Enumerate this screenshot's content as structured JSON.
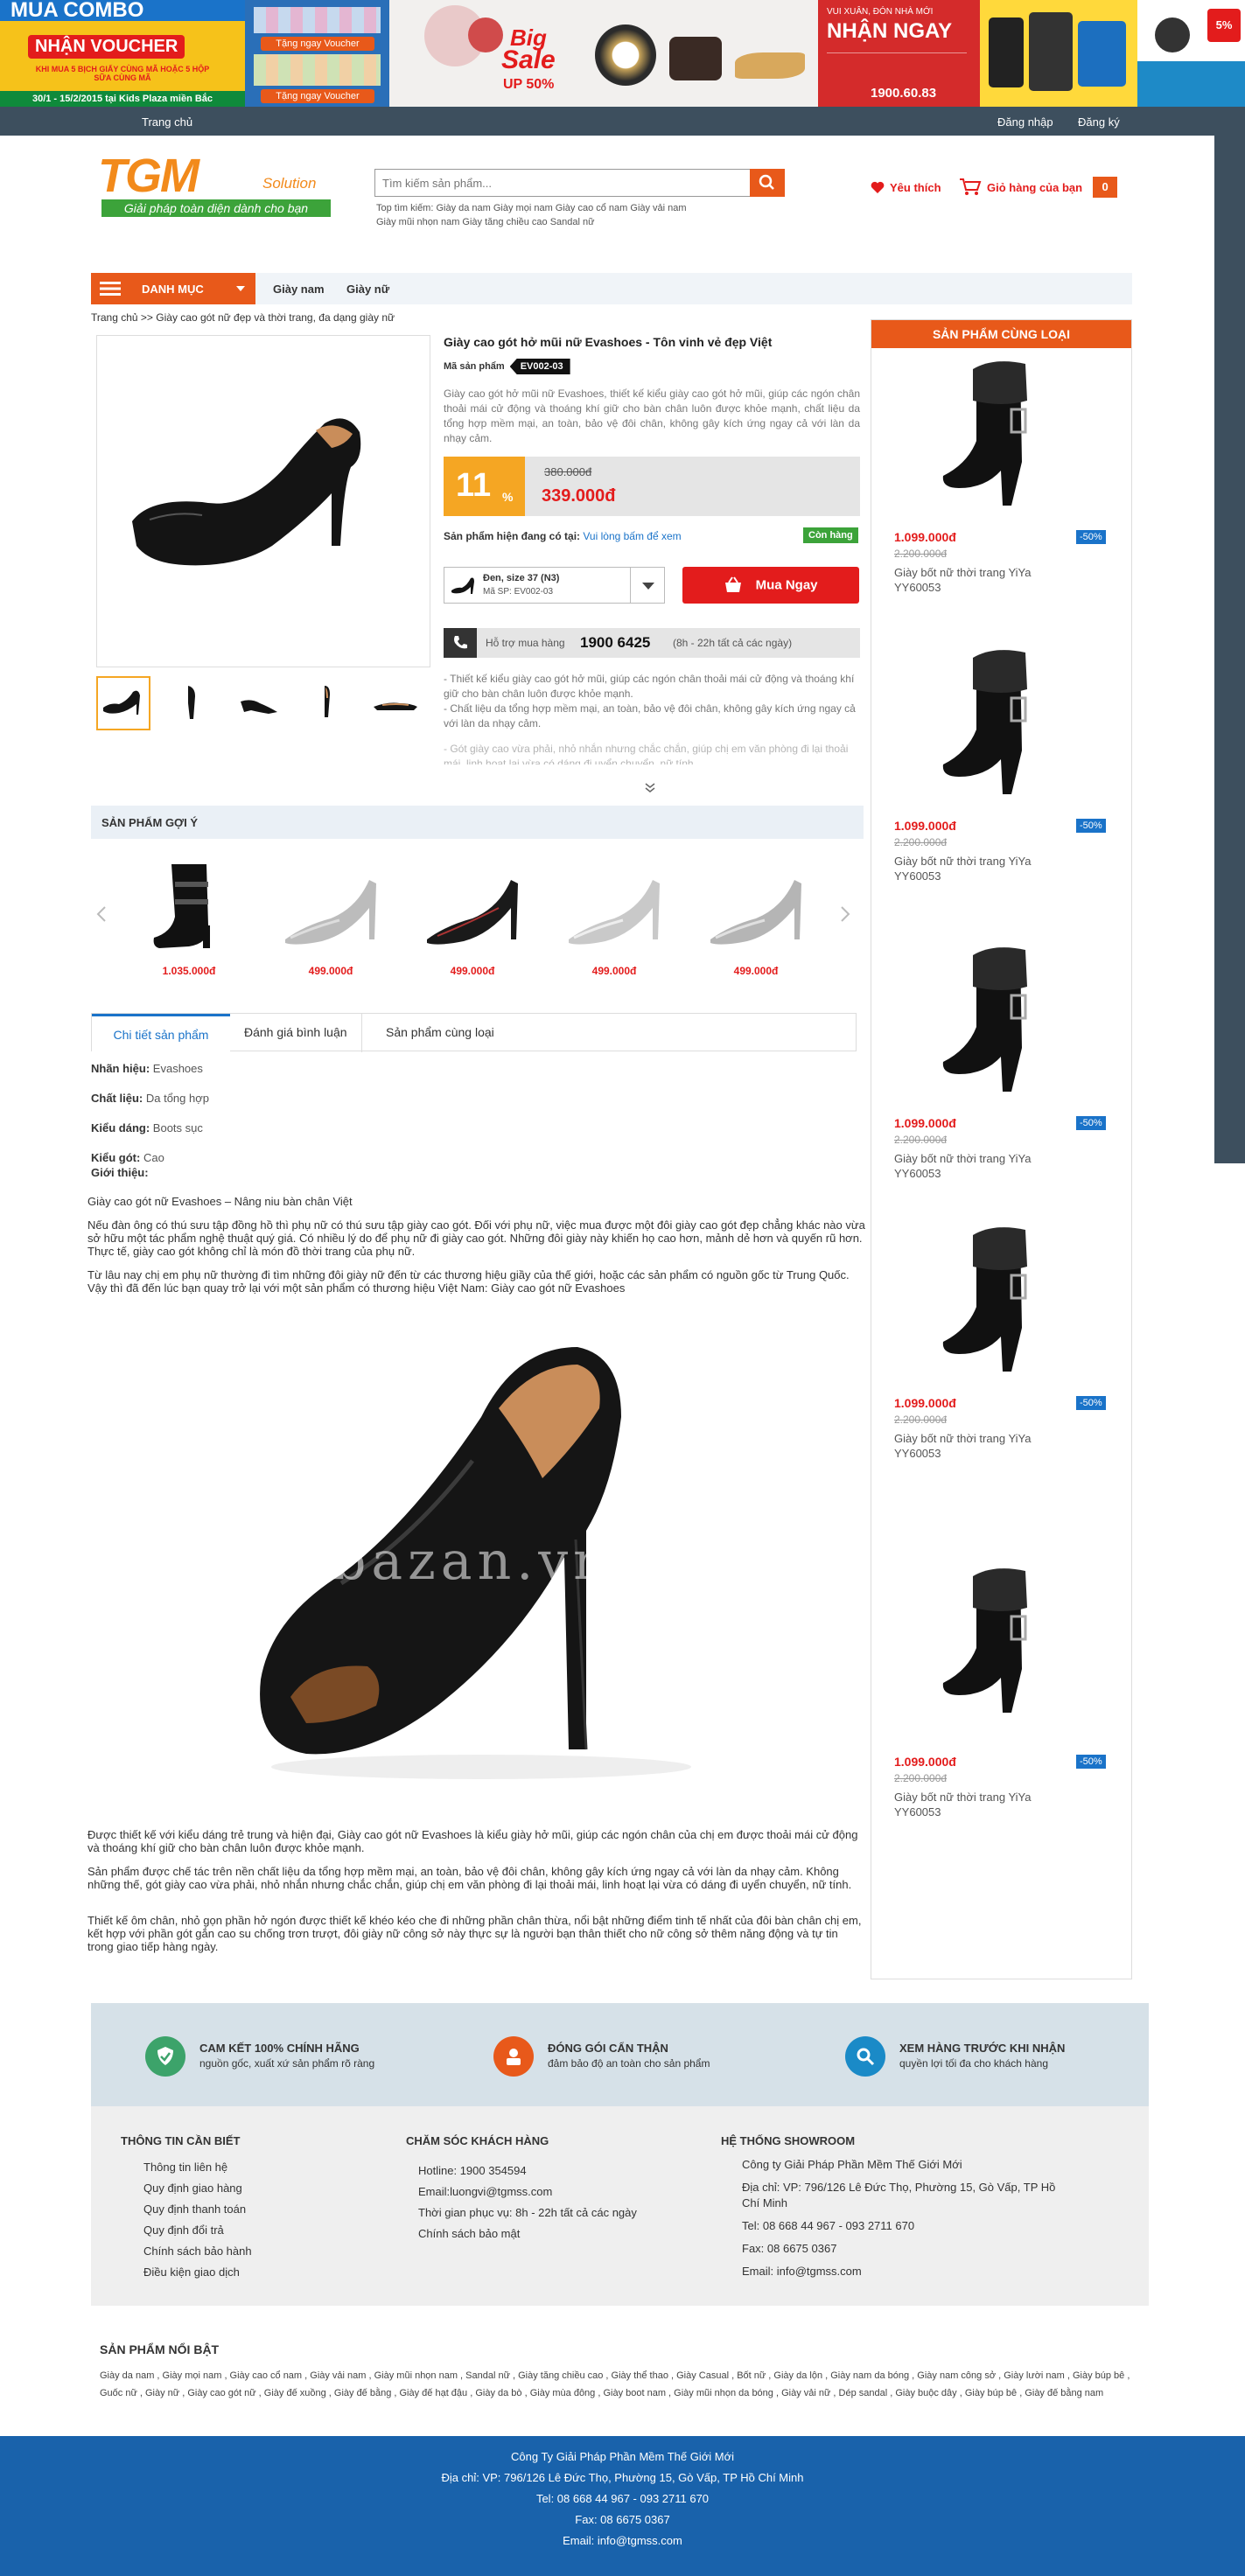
{
  "banners": {
    "b1_title": "MUA COMBO",
    "b1_sub": "NHẬN VOUCHER",
    "b1_small": "KHI MUA 5 BỊCH GIẤY CÙNG MÃ HOẶC 5 HỘP SỮA CÙNG MÃ",
    "b1_date": "30/1 - 15/2/2015 tại Kids Plaza miền Bắc",
    "b2_btn1": "Tặng ngay Voucher",
    "b2_btn2": "Tặng ngay Voucher",
    "b3_text1": "Big",
    "b3_text2": "Sale",
    "b3_text3": "UP 50%",
    "b4_small": "VUI XUÂN, ĐÓN NHÀ MỚI",
    "b4_title": "NHẬN NGAY",
    "b4_phone": "1900.60.83",
    "b6_text": "5%"
  },
  "topnav": {
    "home": "Trang chủ",
    "login": "Đăng nhập",
    "register": "Đăng ký"
  },
  "header": {
    "logo_text": "TGM",
    "logo_suffix": "Solution",
    "logo_tagline": "Giải pháp toàn diện dành cho bạn",
    "search_placeholder": "Tìm kiếm sản phẩm...",
    "top_search_line1": "Top tìm kiếm: Giày da nam Giày mọi nam Giày cao cổ nam Giày vải nam",
    "top_search_line2": "Giày mũi nhọn nam Giày tăng chiều cao Sandal nữ",
    "wishlist": "Yêu thích",
    "cart": "Giỏ hàng của bạn",
    "cart_count": "0"
  },
  "catnav": {
    "menu": "DANH MỤC",
    "items": [
      "Giày nam",
      "Giày nữ"
    ]
  },
  "breadcrumb": "Trang chủ >> Giày cao gót nữ đẹp và thời trang, đa dạng giày nữ",
  "product": {
    "title": "Giày cao gót hở mũi nữ Evashoes - Tôn vinh vẻ đẹp Việt",
    "code_label": "Mã sản phẩm",
    "code": "EV002-03",
    "desc": "Giày cao gót hở mũi nữ Evashoes, thiết kế kiểu giày cao gót hở mũi, giúp các ngón chân thoải mái cử động và thoáng khí giữ cho bàn chân luôn được khỏe mạnh, chất liệu da tổng hợp mềm mại, an toàn, bảo vệ đôi chân, không gây kích ứng ngay cả với làn da nhạy cảm.",
    "discount": "11",
    "discount_unit": "%",
    "old_price": "380.000đ",
    "price": "339.000đ",
    "avail_label": "Sản phẩm hiện đang có tại:",
    "avail_link": "Vui lòng bấm để xem",
    "stock": "Còn hàng",
    "variant_name": "Đen, size 37 (N3)",
    "variant_code": "Mã SP: EV002-03",
    "buy": "Mua Ngay",
    "hotline_label": "Hỗ trợ mua hàng",
    "hotline": "1900 6425",
    "hotline_hours": "(8h - 22h tất cả các ngày)",
    "bullet1": "- Thiết kế kiểu giày cao gót hở mũi, giúp các ngón chân thoải mái cử động và thoáng khí giữ cho bàn chân luôn được khỏe mạnh.",
    "bullet2": "- Chất liệu da tổng hợp mềm mại, an toàn, bảo vệ đôi chân, không gây kích ứng ngay cả với làn da nhạy cảm.",
    "bullet3": "- Gót giày cao vừa phải, nhỏ nhắn nhưng chắc chắn, giúp chị em văn phòng đi lại thoải mái, linh hoạt lại vừa có dáng đi uyển chuyển, nữ tính."
  },
  "suggest": {
    "heading": "SẢN PHẨM GỢI Ý",
    "items": [
      {
        "price": "1.035.000đ"
      },
      {
        "price": "499.000đ"
      },
      {
        "price": "499.000đ"
      },
      {
        "price": "499.000đ"
      },
      {
        "price": "499.000đ"
      }
    ]
  },
  "tabs": [
    "Chi tiết sản phẩm",
    "Đánh giá bình luận",
    "Sản phẩm cùng loại"
  ],
  "specs": {
    "brand_label": "Nhãn hiệu:",
    "brand": "Evashoes",
    "material_label": "Chất liệu:",
    "material": "Da tổng hợp",
    "style_label": "Kiểu dáng:",
    "style": "Boots sục",
    "heel_label": "Kiểu gót:",
    "heel": "Cao",
    "intro_label": "Giới thiệu:"
  },
  "article": {
    "p1": "Giày cao gót nữ Evashoes – Nâng niu bàn chân Việt",
    "p2": "Nếu đàn ông có thú sưu tập đồng hồ thì phụ nữ có thú sưu tập giày cao gót. Đối với phụ nữ, việc mua được một đôi giày cao gót đẹp chẳng khác nào vừa sở hữu một tác phẩm nghệ thuật quý giá. Có nhiều lý do để phụ nữ đi giày cao gót. Những đôi giày này khiến họ cao hơn, mảnh dẻ hơn và quyến rũ hơn. Thực tế, giày cao gót không chỉ là món đồ thời trang của phụ nữ.",
    "p3": " Từ lâu nay chị em phụ nữ thường đi tìm những đôi  giày nữ   đến từ các thương hiệu giầy của thế giới, hoặc các sản phẩm có nguồn gốc từ Trung Quốc. Vậy thì đã đến lúc bạn quay trở lại với một sản phẩm có thương hiệu Việt Nam: Giày cao gót nữ Evashoes",
    "watermark": "bazan.vn",
    "p4": " Được thiết kế với kiểu dáng trẻ trung và hiện đại, Giày cao gót nữ Evashoes  là kiểu giày hở mũi, giúp các ngón chân của chị em được thoải mái cử động và thoáng khí giữ cho bàn chân luôn được khỏe mạnh.",
    "p5": "Sản phẩm được chế tác trên nền chất liệu da tổng hợp mềm mại, an toàn, bảo vệ đôi chân, không gây kích ứng ngay cả với làn da nhạy cảm. Không những thế, gót giày cao vừa phải, nhỏ nhắn nhưng chắc chắn, giúp chị em văn phòng đi lại thoải mái, linh hoạt lại vừa có dáng đi uyển chuyển, nữ tính.",
    "p6": " Thiết kế ôm chân, nhỏ gọn phần hở ngón được thiết kế khéo kéo che đi những phần chân thừa, nổi bật những điểm tinh tế nhất của đôi bàn chân chị em, kết hợp với phần gót gắn cao su chống trơn trượt, đôi   giày nữ công sở   này thực sự là người bạn thân thiết cho nữ công sở thêm năng động và tự tin trong giao tiếp hàng ngày."
  },
  "sidebar": {
    "heading": "SẢN PHẨM CÙNG LOẠI",
    "items": [
      {
        "price": "1.099.000đ",
        "old": "2.200.000đ",
        "badge": "-50%",
        "name": "Giày bốt nữ thời trang YiYa YY60053"
      },
      {
        "price": "1.099.000đ",
        "old": "2.200.000đ",
        "badge": "-50%",
        "name": "Giày bốt nữ thời trang YiYa YY60053"
      },
      {
        "price": "1.099.000đ",
        "old": "2.200.000đ",
        "badge": "-50%",
        "name": "Giày bốt nữ thời trang YiYa YY60053"
      },
      {
        "price": "1.099.000đ",
        "old": "2.200.000đ",
        "badge": "-50%",
        "name": "Giày bốt nữ thời trang YiYa YY60053"
      },
      {
        "price": "1.099.000đ",
        "old": "2.200.000đ",
        "badge": "-50%",
        "name": "Giày bốt nữ thời trang YiYa YY60053"
      }
    ]
  },
  "commitments": [
    {
      "title": "CAM KẾT 100% CHÍNH HÃNG",
      "sub": "nguồn gốc, xuất xứ sản phẩm rõ ràng"
    },
    {
      "title": "ĐÓNG GÓI CẨN THẬN",
      "sub": "đảm bảo độ an toàn cho sản phẩm"
    },
    {
      "title": "XEM HÀNG TRƯỚC KHI NHẬN",
      "sub": "quyền lợi tối đa cho khách hàng"
    }
  ],
  "footer": {
    "col1_title": "THÔNG TIN CẦN BIẾT",
    "col1": [
      "Thông tin liên hệ",
      "Quy định giao hàng",
      "Quy định thanh toán",
      "Quy định đổi trả",
      "Chính sách bảo hành",
      "Điều kiện giao dịch"
    ],
    "col2_title": "CHĂM SÓC KHÁCH HÀNG",
    "col2": [
      "Hotline: 1900 354594",
      "Email:luongvi@tgmss.com",
      "Thời gian phục vụ: 8h - 22h tất cả các ngày",
      "Chính sách bảo mật"
    ],
    "col3_title": "HỆ THỐNG SHOWROOM",
    "col3": [
      "Công ty Giải Pháp Phần Mềm Thế Giới Mới",
      "Địa chỉ: VP: 796/126 Lê Đức Thọ, Phường 15, Gò Vấp, TP Hồ Chí Minh",
      "Tel: 08 668 44 967 - 093 2711 670",
      "Fax: 08 6675 0367",
      "Email: info@tgmss.com"
    ],
    "featured_title": "SẢN PHẨM NỔI BẬT",
    "featured": "Giày da nam , Giày mọi nam , Giày cao cổ nam , Giày vải nam , Giày mũi nhọn nam , Sandal nữ , Giày tăng chiều cao , Giày thể thao , Giày Casual , Bốt nữ , Giày da lộn , Giày nam da bóng , Giày nam công sở , Giày lười nam , Giày búp bê , Guốc nữ , Giày nữ , Giày cao gót nữ , Giày đế xuồng , Giày đế bằng , Giày đế hạt đậu , Giày da bò , Giày mùa đông , Giày boot nam , Giày mũi nhọn da bóng , Giày vải nữ , Dép sandal , Giày buộc dây , Giày búp bê , Giày đế bằng nam",
    "bottom": [
      "Công Ty Giải Pháp Phần Mềm Thế Giới Mới",
      "Địa chỉ: VP: 796/126 Lê Đức Thọ, Phường 15, Gò Vấp, TP Hồ Chí Minh",
      "Tel: 08 668 44 967 - 093 2711 670",
      "Fax: 08 6675 0367",
      "Email: info@tgmss.com"
    ]
  },
  "colors": {
    "accent": "#e8591a",
    "red": "#e31c1c",
    "blue": "#1962ab",
    "nav": "#3d4f5e"
  }
}
